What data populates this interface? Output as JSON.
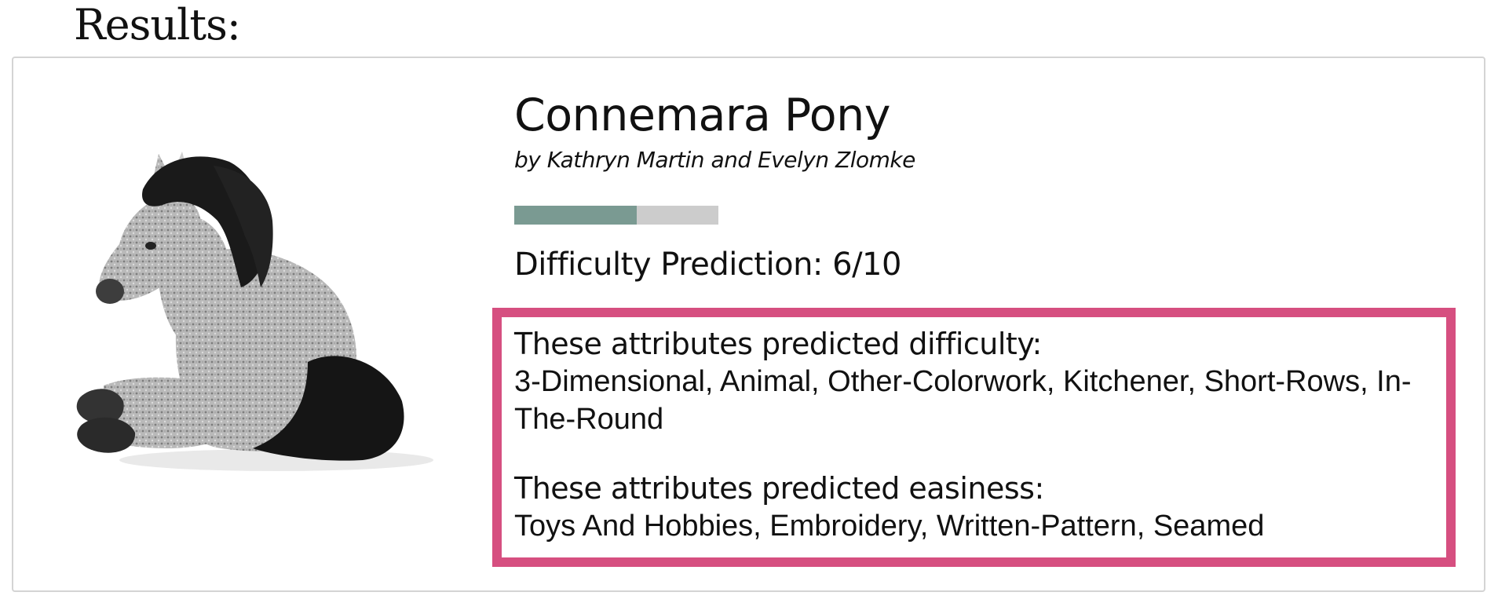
{
  "results_heading": "Results:",
  "pattern": {
    "title": "Connemara Pony",
    "byline": "by Kathryn Martin and Evelyn Zlomke",
    "image_icon": "knitted-pony-image"
  },
  "difficulty": {
    "bar_fraction": 0.6,
    "bar_fill_color": "#7a9a92",
    "bar_track_color": "#cccccc",
    "prediction_text": "Difficulty Prediction: 6/10"
  },
  "attributes": {
    "highlight_color": "#d64f80",
    "difficulty_heading": "These attributes predicted difficulty:",
    "difficulty_list": "3-Dimensional, Animal, Other-Colorwork, Kitchener, Short-Rows, In-The-Round",
    "easiness_heading": "These attributes predicted easiness:",
    "easiness_list": "Toys And Hobbies, Embroidery, Written-Pattern, Seamed"
  }
}
